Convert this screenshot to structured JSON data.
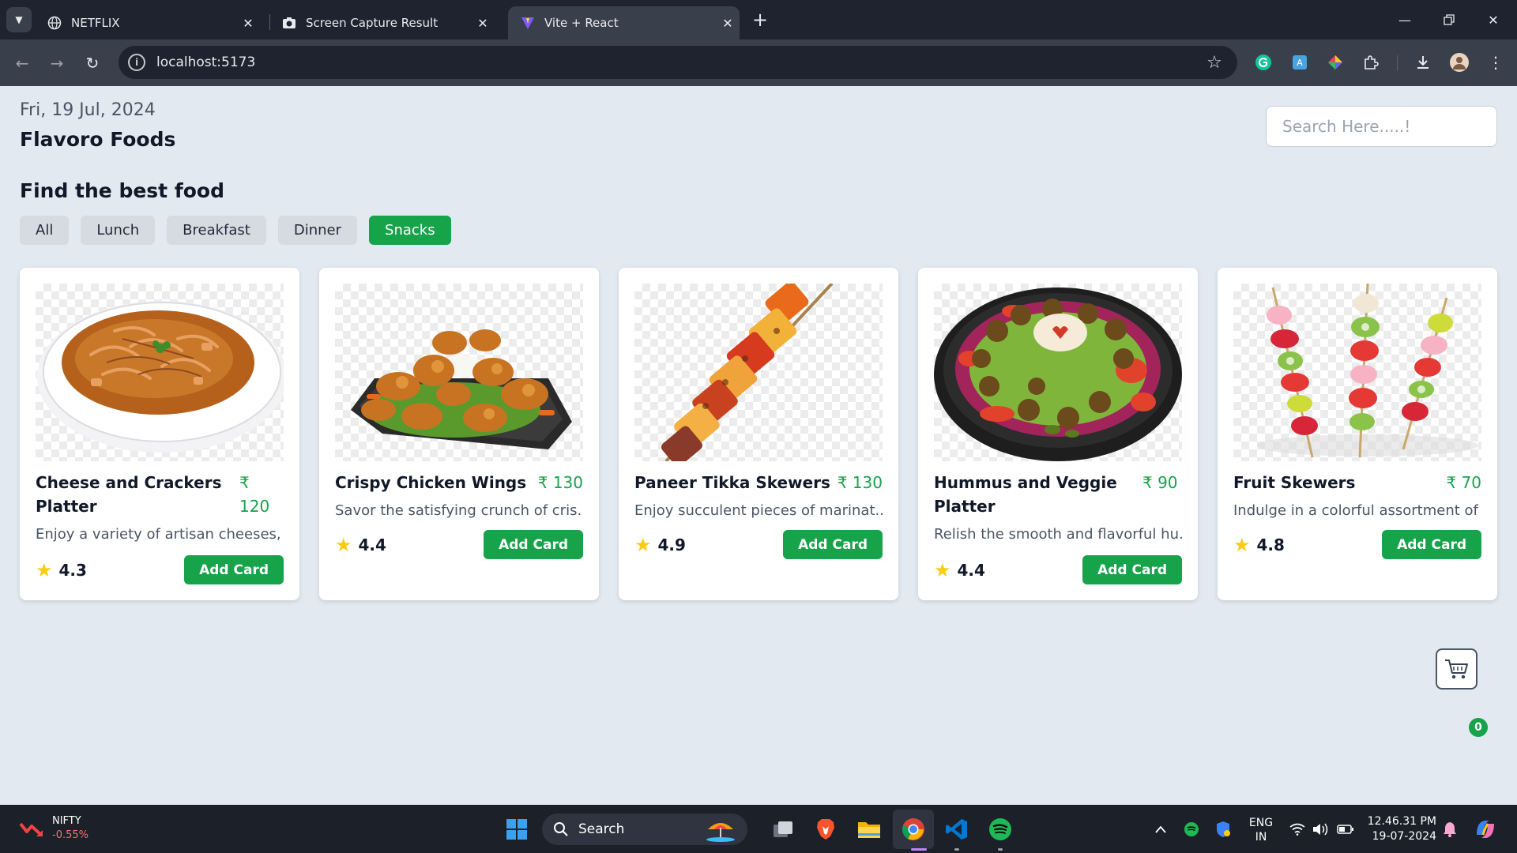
{
  "browser": {
    "tabs": [
      {
        "title": "NETFLIX",
        "favicon": "globe-icon",
        "active": false
      },
      {
        "title": "Screen Capture Result",
        "favicon": "camera-icon",
        "active": false
      },
      {
        "title": "Vite + React",
        "favicon": "vite-icon",
        "active": true
      }
    ],
    "url": "localhost:5173"
  },
  "header": {
    "date": "Fri, 19 Jul, 2024",
    "brand": "Flavoro Foods",
    "search_placeholder": "Search Here.....!"
  },
  "main": {
    "section_title": "Find the best food",
    "filters": [
      {
        "label": "All",
        "active": false
      },
      {
        "label": "Lunch",
        "active": false
      },
      {
        "label": "Breakfast",
        "active": false
      },
      {
        "label": "Dinner",
        "active": false
      },
      {
        "label": "Snacks",
        "active": true
      }
    ],
    "cards": [
      {
        "name": "Cheese and Crackers Platter",
        "price": "₹ 120",
        "description": "Enjoy a variety of artisan cheeses, ...",
        "rating": "4.3",
        "button": "Add Card",
        "image": "soup-bowl"
      },
      {
        "name": "Crispy Chicken Wings",
        "price": "₹ 130",
        "description": "Savor the satisfying crunch of cris...",
        "rating": "4.4",
        "button": "Add Card",
        "image": "chicken-wings-platter"
      },
      {
        "name": "Paneer Tikka Skewers",
        "price": "₹ 130",
        "description": "Enjoy succulent pieces of marinat...",
        "rating": "4.9",
        "button": "Add Card",
        "image": "paneer-skewer"
      },
      {
        "name": "Hummus and Veggie Platter",
        "price": "₹ 90",
        "description": "Relish the smooth and flavorful hu...",
        "rating": "4.4",
        "button": "Add Card",
        "image": "hummus-platter"
      },
      {
        "name": "Fruit Skewers",
        "price": "₹ 70",
        "description": "Indulge in a colorful assortment of ...",
        "rating": "4.8",
        "button": "Add Card",
        "image": "fruit-skewers"
      }
    ],
    "cart_count": "0"
  },
  "taskbar": {
    "stock_name": "NIFTY",
    "stock_change": "-0.55%",
    "search_label": "Search",
    "lang_line1": "ENG",
    "lang_line2": "IN",
    "time": "12.46.31 PM",
    "date": "19-07-2024"
  },
  "colors": {
    "accent": "#16a34a",
    "page_bg": "#e3e9f1",
    "rating_star": "#facc15"
  }
}
